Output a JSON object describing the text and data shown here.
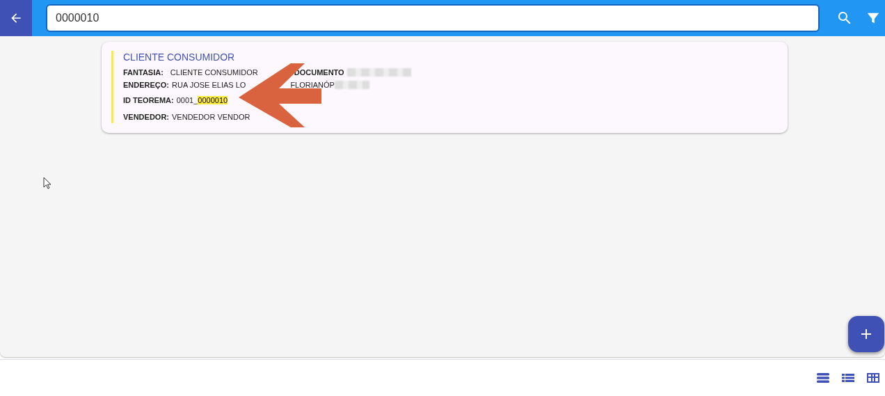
{
  "search": {
    "value": "0000010"
  },
  "cards": [
    {
      "title": "CLIENTE CONSUMIDOR",
      "fields": [
        {
          "kind": "pair",
          "parts": [
            {
              "label": "FANTASIA:",
              "value": "CLIENTE CONSUMIDOR"
            },
            {
              "label": "DOCUMENTO"
            }
          ]
        },
        {
          "kind": "split",
          "label": "ENDEREÇO:",
          "value": "RUA JOSE ELIAS LO",
          "tail": "FLORIANÓP"
        },
        {
          "kind": "highlight",
          "label": "ID TEOREMA:",
          "value": "0001_",
          "match": "0000010"
        },
        {
          "kind": "plain",
          "label": "VENDEDOR:",
          "value": "VENDEDOR VENDOR"
        }
      ]
    }
  ],
  "annotation": {
    "kind": "arrow",
    "color": "#d9623f"
  }
}
